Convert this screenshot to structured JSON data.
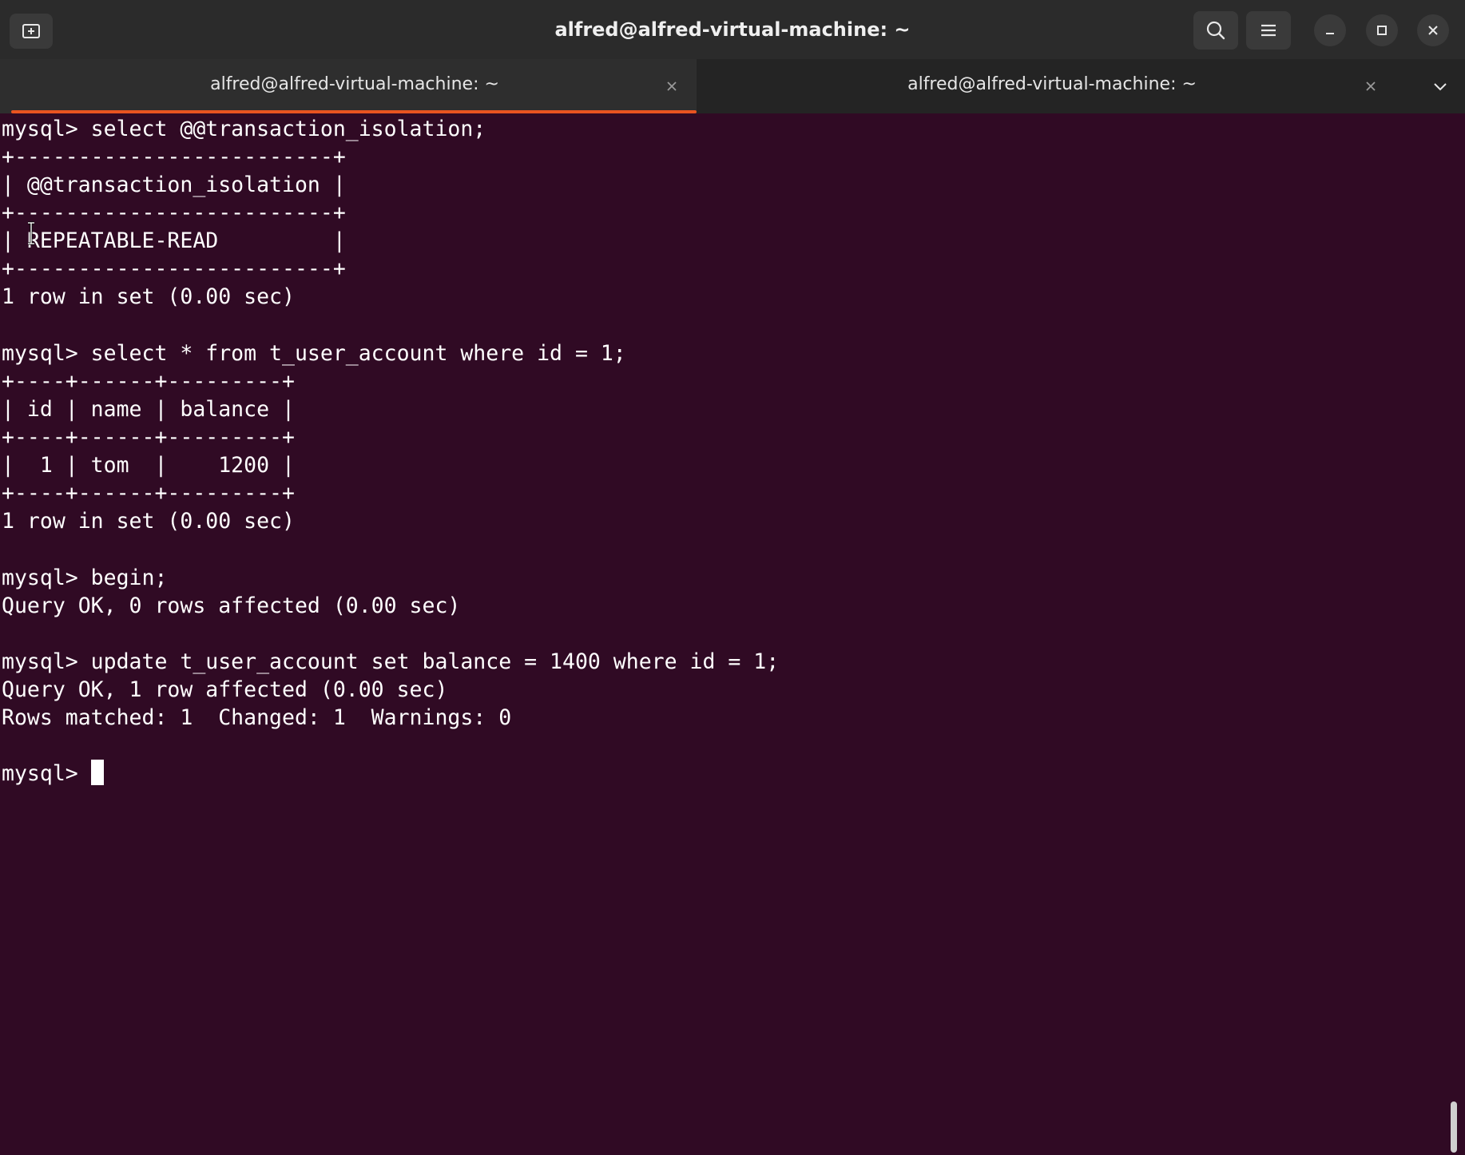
{
  "window": {
    "title": "alfred@alfred-virtual-machine: ~"
  },
  "header": {
    "icons": {
      "new_tab": "new-tab-icon",
      "search": "search-icon",
      "menu": "hamburger-menu-icon",
      "minimize": "minimize-icon",
      "maximize": "maximize-icon",
      "close": "close-icon"
    }
  },
  "tabs": [
    {
      "label": "alfred@alfred-virtual-machine: ~",
      "active": true
    },
    {
      "label": "alfred@alfred-virtual-machine: ~",
      "active": false
    }
  ],
  "colors": {
    "terminal_bg": "#300a24",
    "accent": "#e95420",
    "header_bg": "#2b2b2b"
  },
  "terminal": {
    "lines": [
      "mysql> select @@transaction_isolation;",
      "+-------------------------+",
      "| @@transaction_isolation |",
      "+-------------------------+",
      "| REPEATABLE-READ         |",
      "+-------------------------+",
      "1 row in set (0.00 sec)",
      "",
      "mysql> select * from t_user_account where id = 1;",
      "+----+------+---------+",
      "| id | name | balance |",
      "+----+------+---------+",
      "|  1 | tom  |    1200 |",
      "+----+------+---------+",
      "1 row in set (0.00 sec)",
      "",
      "mysql> begin;",
      "Query OK, 0 rows affected (0.00 sec)",
      "",
      "mysql> update t_user_account set balance = 1400 where id = 1;",
      "Query OK, 1 row affected (0.00 sec)",
      "Rows matched: 1  Changed: 1  Warnings: 0",
      "",
      "mysql> "
    ]
  }
}
